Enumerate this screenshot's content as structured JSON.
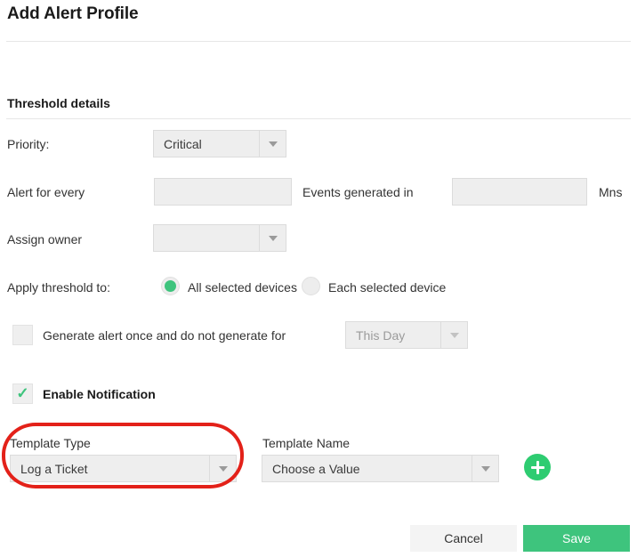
{
  "dialog": {
    "title": "Add Alert Profile",
    "section_title": "Threshold details"
  },
  "fields": {
    "priority": {
      "label": "Priority:",
      "value": "Critical",
      "icon": "chevron-down-icon"
    },
    "alert_for_every": {
      "label": "Alert for every",
      "value": "",
      "placeholder": ""
    },
    "events_generated_in": {
      "label": "Events generated in",
      "value": "",
      "placeholder": "",
      "unit": "Mns"
    },
    "assign_owner": {
      "label": "Assign owner",
      "value": "",
      "icon": "chevron-down-icon"
    },
    "apply_threshold": {
      "label": "Apply threshold to:",
      "options": [
        {
          "label": "All selected devices",
          "selected": true
        },
        {
          "label": "Each selected device",
          "selected": false
        }
      ]
    },
    "generate_once": {
      "label": "Generate alert once and do not generate for",
      "checked": false,
      "period_value": "This Day",
      "period_icon": "chevron-down-icon"
    },
    "enable_notification": {
      "label": "Enable Notification",
      "checked": true,
      "icon": "check-icon"
    },
    "template_type": {
      "label": "Template Type",
      "value": "Log a Ticket",
      "icon": "chevron-down-icon"
    },
    "template_name": {
      "label": "Template Name",
      "value": "Choose a Value",
      "icon": "chevron-down-icon"
    },
    "add_template": {
      "icon": "plus-icon"
    }
  },
  "footer": {
    "cancel_label": "Cancel",
    "save_label": "Save"
  },
  "colors": {
    "accent_green": "#3ec47d",
    "plus_green": "#2ecc71",
    "annotation_red": "#e32119",
    "field_bg": "#eeeeee"
  }
}
